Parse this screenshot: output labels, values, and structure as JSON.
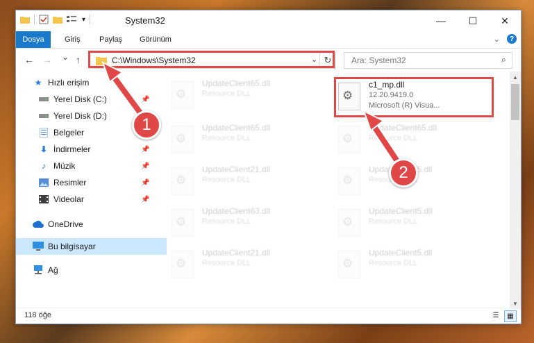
{
  "window": {
    "title": "System32",
    "quick_access": [
      "folder-icon",
      "properties-check-icon",
      "new-folder-icon",
      "view-toggle-icon",
      "chevron-down-icon"
    ],
    "controls": {
      "minimize": "—",
      "maximize": "☐",
      "close": "✕"
    }
  },
  "ribbon": {
    "tabs": [
      {
        "label": "Dosya",
        "active": true
      },
      {
        "label": "Giriş"
      },
      {
        "label": "Paylaş"
      },
      {
        "label": "Görünüm"
      }
    ],
    "help": "?"
  },
  "navbar": {
    "back": "←",
    "forward": "→",
    "recent": "⌄",
    "up": "↑",
    "address": "C:\\Windows\\System32",
    "search_placeholder": "Ara: System32"
  },
  "sidebar": {
    "items": [
      {
        "label": "Hızlı erişim",
        "icon": "star-icon",
        "pinned": false
      },
      {
        "label": "Yerel Disk (C:)",
        "icon": "drive-icon",
        "pinned": true
      },
      {
        "label": "Yerel Disk (D:)",
        "icon": "drive-icon",
        "pinned": true
      },
      {
        "label": "Belgeler",
        "icon": "documents-icon",
        "pinned": true
      },
      {
        "label": "İndirmeler",
        "icon": "download-icon",
        "pinned": true
      },
      {
        "label": "Müzik",
        "icon": "music-icon",
        "pinned": true
      },
      {
        "label": "Resimler",
        "icon": "pictures-icon",
        "pinned": true
      },
      {
        "label": "Videolar",
        "icon": "videos-icon",
        "pinned": true
      },
      {
        "label": "OneDrive",
        "icon": "cloud-icon",
        "pinned": false
      },
      {
        "label": "Bu bilgisayar",
        "icon": "computer-icon",
        "pinned": false,
        "selected": true
      },
      {
        "label": "Ağ",
        "icon": "network-icon",
        "pinned": false
      }
    ]
  },
  "files": {
    "highlighted": {
      "name": "c1_mp.dll",
      "version": "12.20.9419.0",
      "company": "Microsoft (R) Visua..."
    },
    "faded": [
      {
        "name": "UpdateClient65.dll",
        "type": "Resource DLL"
      },
      {
        "name": "UpdateClient65.dll",
        "type": "Resource DLL"
      },
      {
        "name": "UpdateClient65.dll",
        "type": "Resource DLL"
      },
      {
        "name": "UpdateClient21.dll",
        "type": "Resource DLL"
      },
      {
        "name": "UpdateClient5.dll",
        "type": "Resource DLL"
      },
      {
        "name": "UpdateClient63.dll",
        "type": "Resource DLL"
      },
      {
        "name": "UpdateClient5.dll",
        "type": "Resource DLL"
      },
      {
        "name": "UpdateClient21.dll",
        "type": "Resource DLL"
      },
      {
        "name": "UpdateClient5.dll",
        "type": "Resource DLL"
      }
    ]
  },
  "status": {
    "count": "118 öğe"
  },
  "callouts": {
    "step1": "1",
    "step2": "2",
    "color": "#e04848"
  }
}
